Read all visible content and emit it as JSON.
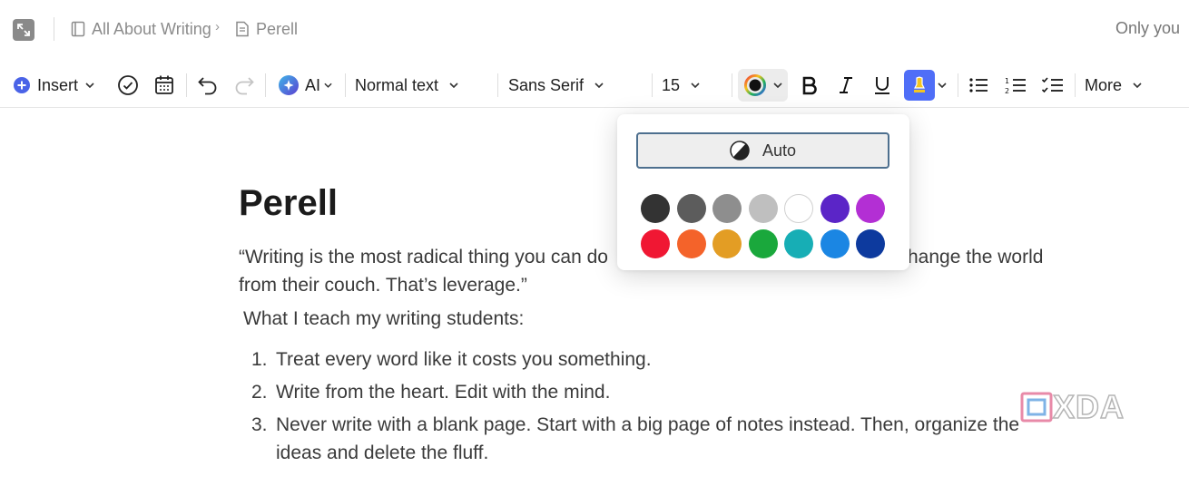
{
  "header": {
    "breadcrumb": [
      {
        "label": "All About Writing",
        "icon": "notebook-icon"
      },
      {
        "label": "Perell",
        "icon": "page-icon"
      }
    ],
    "separator": "›",
    "sharing": "Only you"
  },
  "toolbar": {
    "insert": "Insert",
    "ai": "AI",
    "text_style": "Normal text",
    "font": "Sans Serif",
    "font_size": "15",
    "more": "More",
    "highlight_color": "#4f6ef7"
  },
  "color_popup": {
    "auto_label": "Auto",
    "swatches_row1": [
      "#333333",
      "#5c5c5c",
      "#8e8e8e",
      "#bfbfbf",
      "#ffffff",
      "#5b25c7",
      "#b32fd4"
    ],
    "swatches_row2": [
      "#f01733",
      "#f4632a",
      "#e39d24",
      "#1aa83c",
      "#17aeb5",
      "#1b86e3",
      "#0d3a9e"
    ]
  },
  "document": {
    "title": "Perell",
    "quote_line1": "“Writing is the most radical thing you can do",
    "quote_line1_tail": "hange the world",
    "quote_line2": "from their couch. That’s leverage.”",
    "intro": "What I teach my writing students:",
    "items": [
      {
        "num": "1.",
        "text": "Treat every word like it costs you something."
      },
      {
        "num": "2.",
        "text": "Write from the heart. Edit with the mind."
      },
      {
        "num": "3.",
        "text": "Never write with a blank page. Start with a big page of notes instead. Then, organize the ideas and delete the fluff."
      }
    ]
  },
  "watermark": "XDA"
}
